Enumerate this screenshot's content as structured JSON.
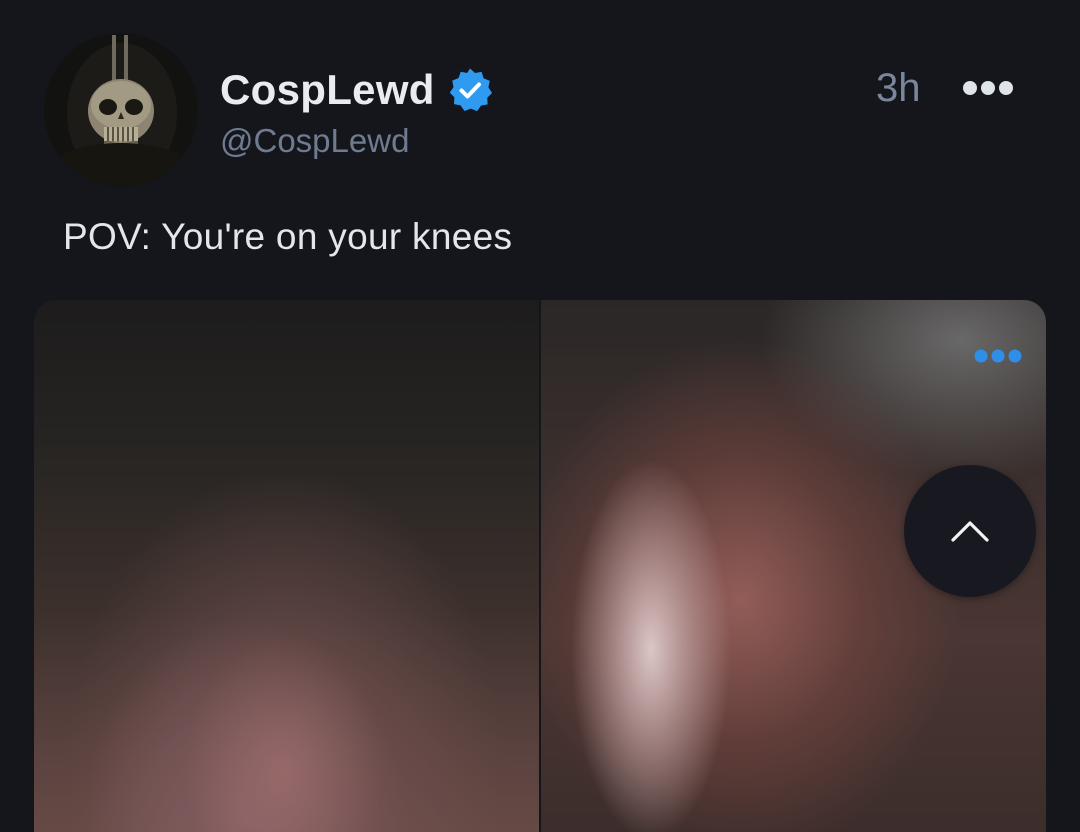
{
  "post": {
    "author": {
      "display_name": "CospLewd",
      "handle": "@CospLewd",
      "verified": true,
      "avatar_icon": "skull-mask-avatar"
    },
    "timestamp": "3h",
    "text": "POV: You're on your knees",
    "media_count": 2
  },
  "icons": {
    "more": "more-horizontal-icon",
    "media_more": "more-horizontal-icon",
    "scroll_top": "chevron-up-icon",
    "verified": "verified-badge-icon"
  },
  "colors": {
    "background": "#15161b",
    "verified_blue": "#2f9bf0",
    "accent_blue": "#2f8fe8"
  }
}
